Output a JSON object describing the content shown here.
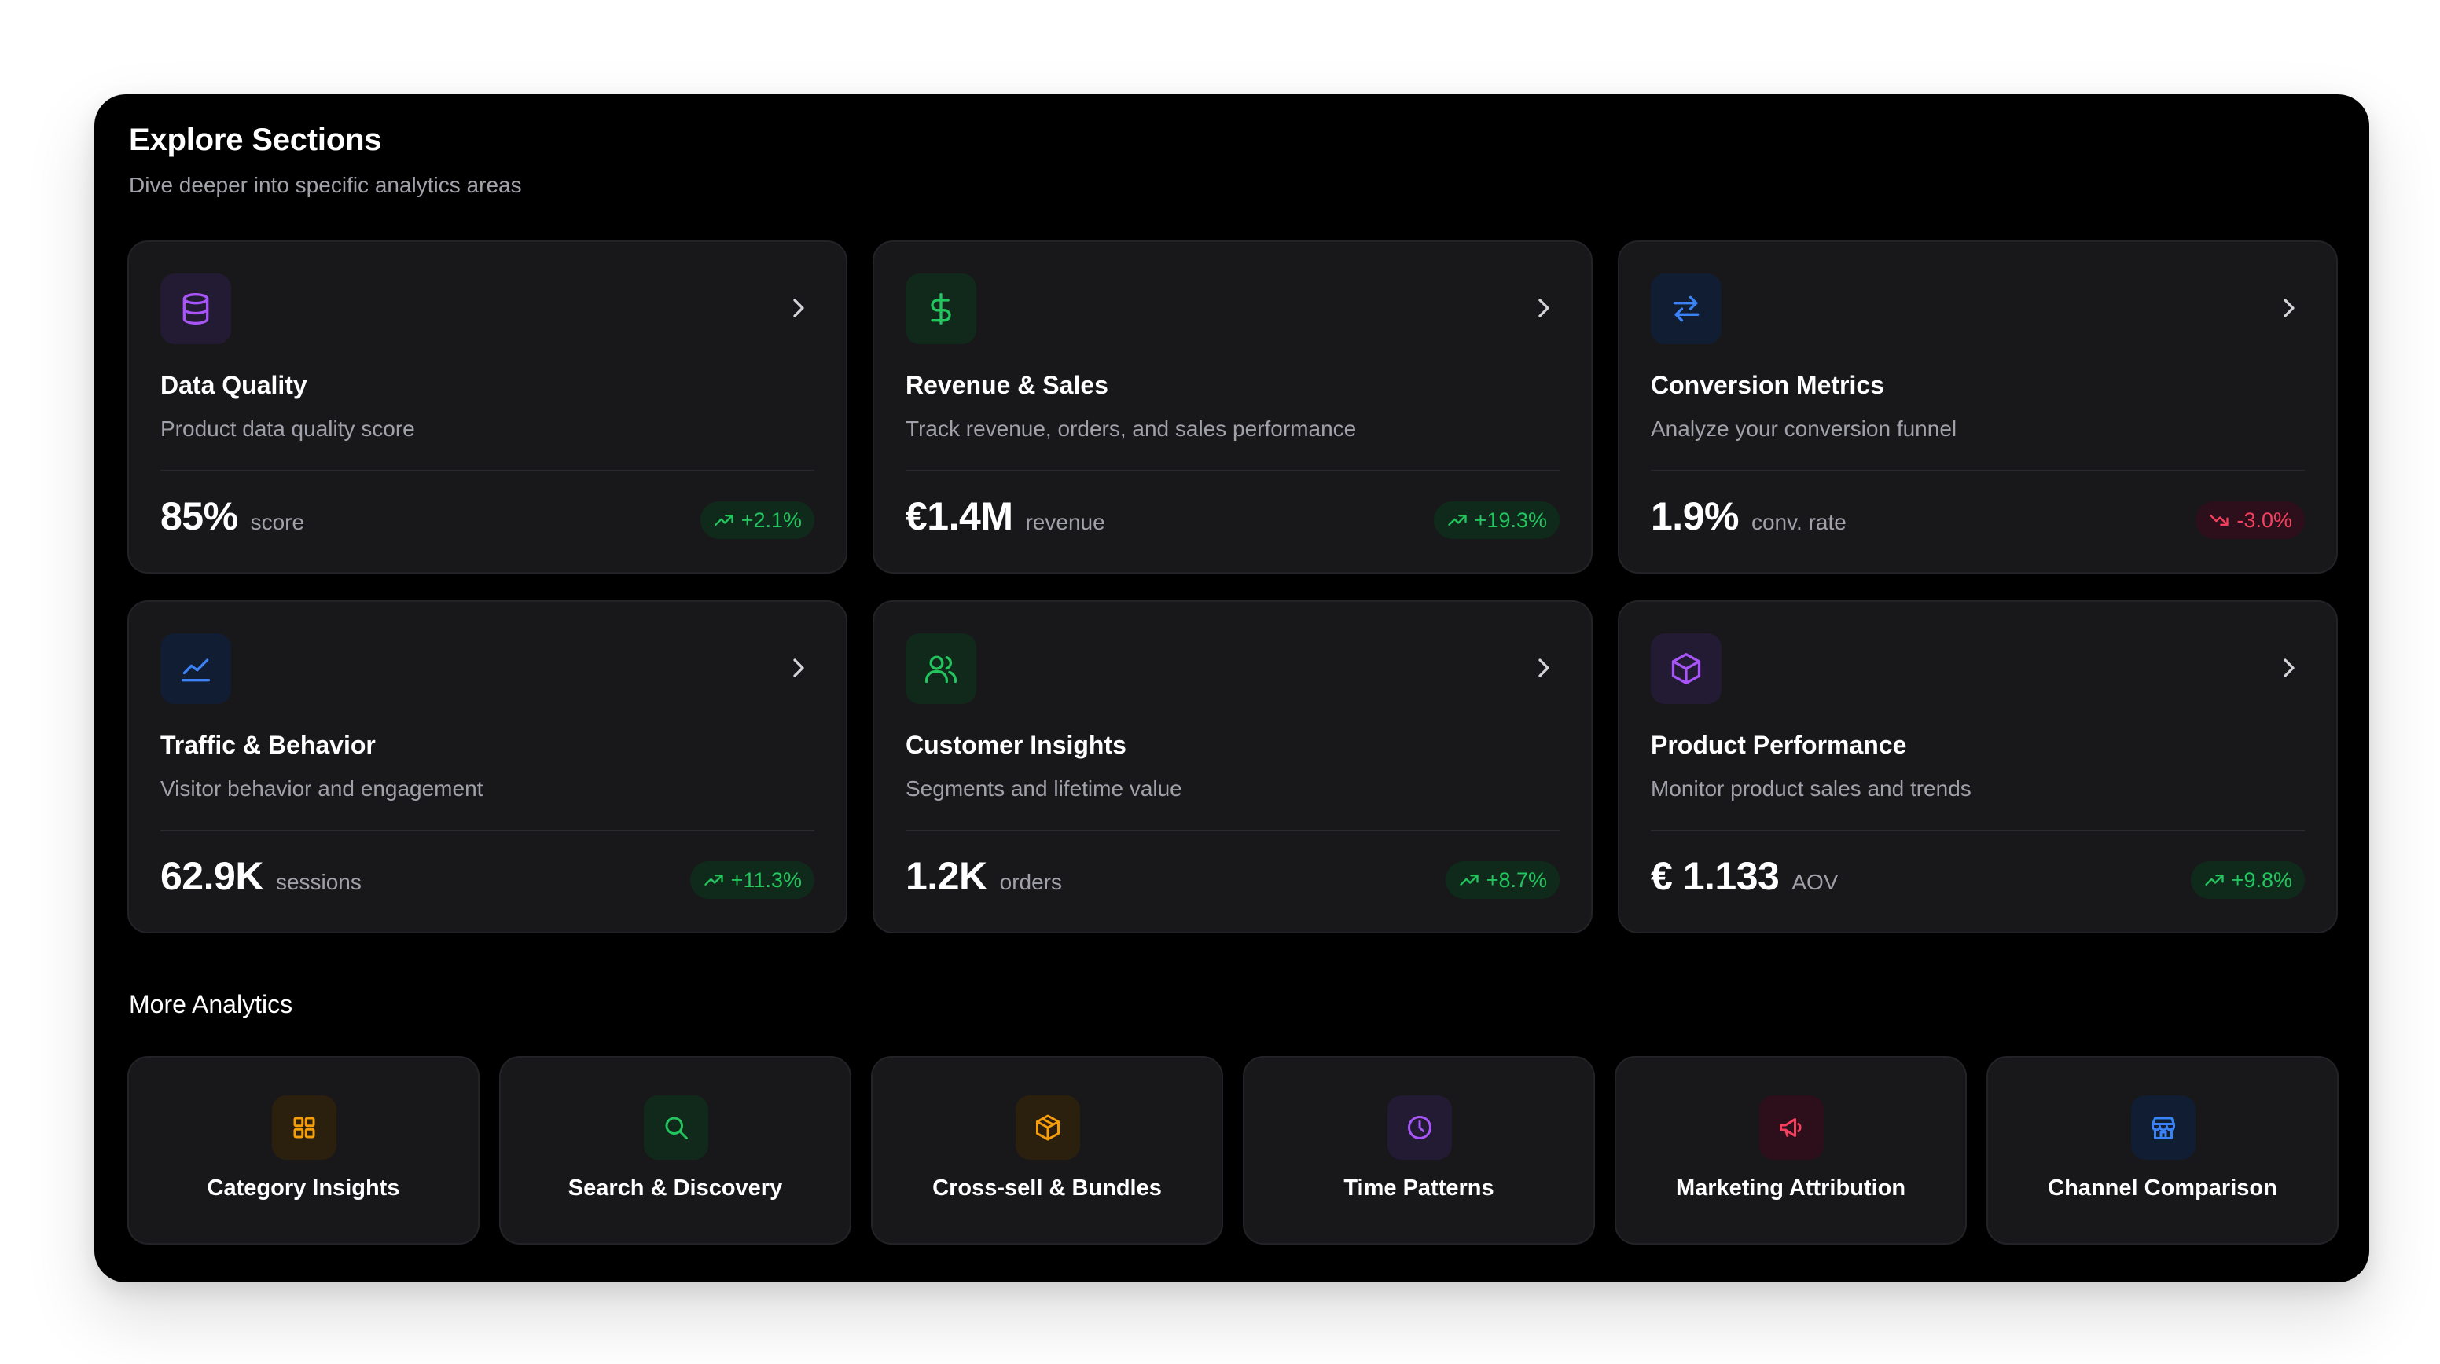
{
  "header": {
    "title": "Explore Sections",
    "subtitle": "Dive deeper into specific analytics areas"
  },
  "sections": [
    {
      "title": "Data Quality",
      "description": "Product data quality score",
      "value": "85%",
      "unit": "score",
      "change": "+2.1%",
      "trend": "up",
      "icon": "database-icon",
      "accent": "#a855f7"
    },
    {
      "title": "Revenue & Sales",
      "description": "Track revenue, orders, and sales performance",
      "value": "€1.4M",
      "unit": "revenue",
      "change": "+19.3%",
      "trend": "up",
      "icon": "dollar-icon",
      "accent": "#22c55e"
    },
    {
      "title": "Conversion Metrics",
      "description": "Analyze your conversion funnel",
      "value": "1.9%",
      "unit": "conv. rate",
      "change": "-3.0%",
      "trend": "down",
      "icon": "arrows-swap-icon",
      "accent": "#3b82f6"
    },
    {
      "title": "Traffic & Behavior",
      "description": "Visitor behavior and engagement",
      "value": "62.9K",
      "unit": "sessions",
      "change": "+11.3%",
      "trend": "up",
      "icon": "line-chart-icon",
      "accent": "#3b82f6"
    },
    {
      "title": "Customer Insights",
      "description": "Segments and lifetime value",
      "value": "1.2K",
      "unit": "orders",
      "change": "+8.7%",
      "trend": "up",
      "icon": "users-icon",
      "accent": "#22c55e"
    },
    {
      "title": "Product Performance",
      "description": "Monitor product sales and trends",
      "value": "€ 1.133",
      "unit": "AOV",
      "change": "+9.8%",
      "trend": "up",
      "icon": "package-icon",
      "accent": "#a855f7"
    }
  ],
  "more": {
    "title": "More Analytics",
    "items": [
      {
        "label": "Category Insights",
        "icon": "grid-icon",
        "accent": "#f59e0b"
      },
      {
        "label": "Search & Discovery",
        "icon": "search-icon",
        "accent": "#22c55e"
      },
      {
        "label": "Cross-sell & Bundles",
        "icon": "box-icon",
        "accent": "#f59e0b"
      },
      {
        "label": "Time Patterns",
        "icon": "clock-icon",
        "accent": "#a855f7"
      },
      {
        "label": "Marketing Attribution",
        "icon": "megaphone-icon",
        "accent": "#f43f5e"
      },
      {
        "label": "Channel Comparison",
        "icon": "store-icon",
        "accent": "#3b82f6"
      }
    ]
  },
  "colors": {
    "background": "#000000",
    "card": "#18181b",
    "positive": "#22c55e",
    "negative": "#f43f5e"
  }
}
